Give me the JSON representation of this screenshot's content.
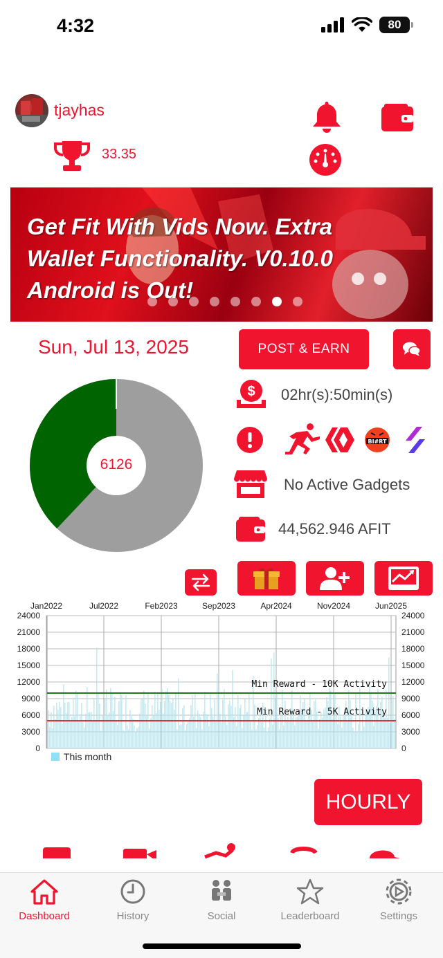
{
  "status": {
    "time": "4:32",
    "battery": "80"
  },
  "user": {
    "name": "tjayhas",
    "score": "33.35"
  },
  "banner": {
    "text": "Get Fit With Vids Now. Extra Wallet Functionality. V0.10.0 Android is Out!",
    "dots": 7,
    "active_dot": 6
  },
  "date": "Sun, Jul 13, 2025",
  "post_button": "POST & EARN",
  "donut": {
    "center_value": "6126",
    "green_fraction": 0.38,
    "colors": {
      "done": "#006400",
      "remaining": "#9e9e9e"
    }
  },
  "info": {
    "timer": "02hr(s):50min(s)",
    "gadgets": "No Active Gadgets",
    "balance": "44,562.946 AFIT"
  },
  "activity_chart": {
    "x_ticks": [
      "Jan2022",
      "Jul2022",
      "Feb2023",
      "Sep2023",
      "Apr2024",
      "Nov2024",
      "Jun2025"
    ],
    "y_ticks": [
      "24000",
      "21000",
      "18000",
      "15000",
      "12000",
      "9000",
      "6000",
      "3000",
      "0"
    ],
    "line1_label": "Min Reward - 10K Activity",
    "line2_label": "Min Reward - 5K Activity",
    "legend": "This month"
  },
  "chart_data": {
    "type": "bar",
    "x_ticks": [
      "Jan2022",
      "Jul2022",
      "Feb2023",
      "Sep2023",
      "Apr2024",
      "Nov2024",
      "Jun2025"
    ],
    "ylim": [
      0,
      24000
    ],
    "series": [
      {
        "name": "This month"
      }
    ],
    "reference_lines": [
      {
        "label": "Min Reward - 10K Activity",
        "value": 10000,
        "color": "#1a7a1a"
      },
      {
        "label": "Min Reward - 5K Activity",
        "value": 5000,
        "color": "#e03030"
      }
    ],
    "bar_color": "#a8e6f5",
    "grid": true,
    "legend_position": "bottom-left"
  },
  "hourly_button": "HOURLY",
  "tabs": [
    {
      "label": "Dashboard",
      "icon": "home-icon",
      "active": true
    },
    {
      "label": "History",
      "icon": "clock-icon",
      "active": false
    },
    {
      "label": "Social",
      "icon": "social-icon",
      "active": false
    },
    {
      "label": "Leaderboard",
      "icon": "star-icon",
      "active": false
    },
    {
      "label": "Settings",
      "icon": "gear-icon",
      "active": false
    }
  ]
}
